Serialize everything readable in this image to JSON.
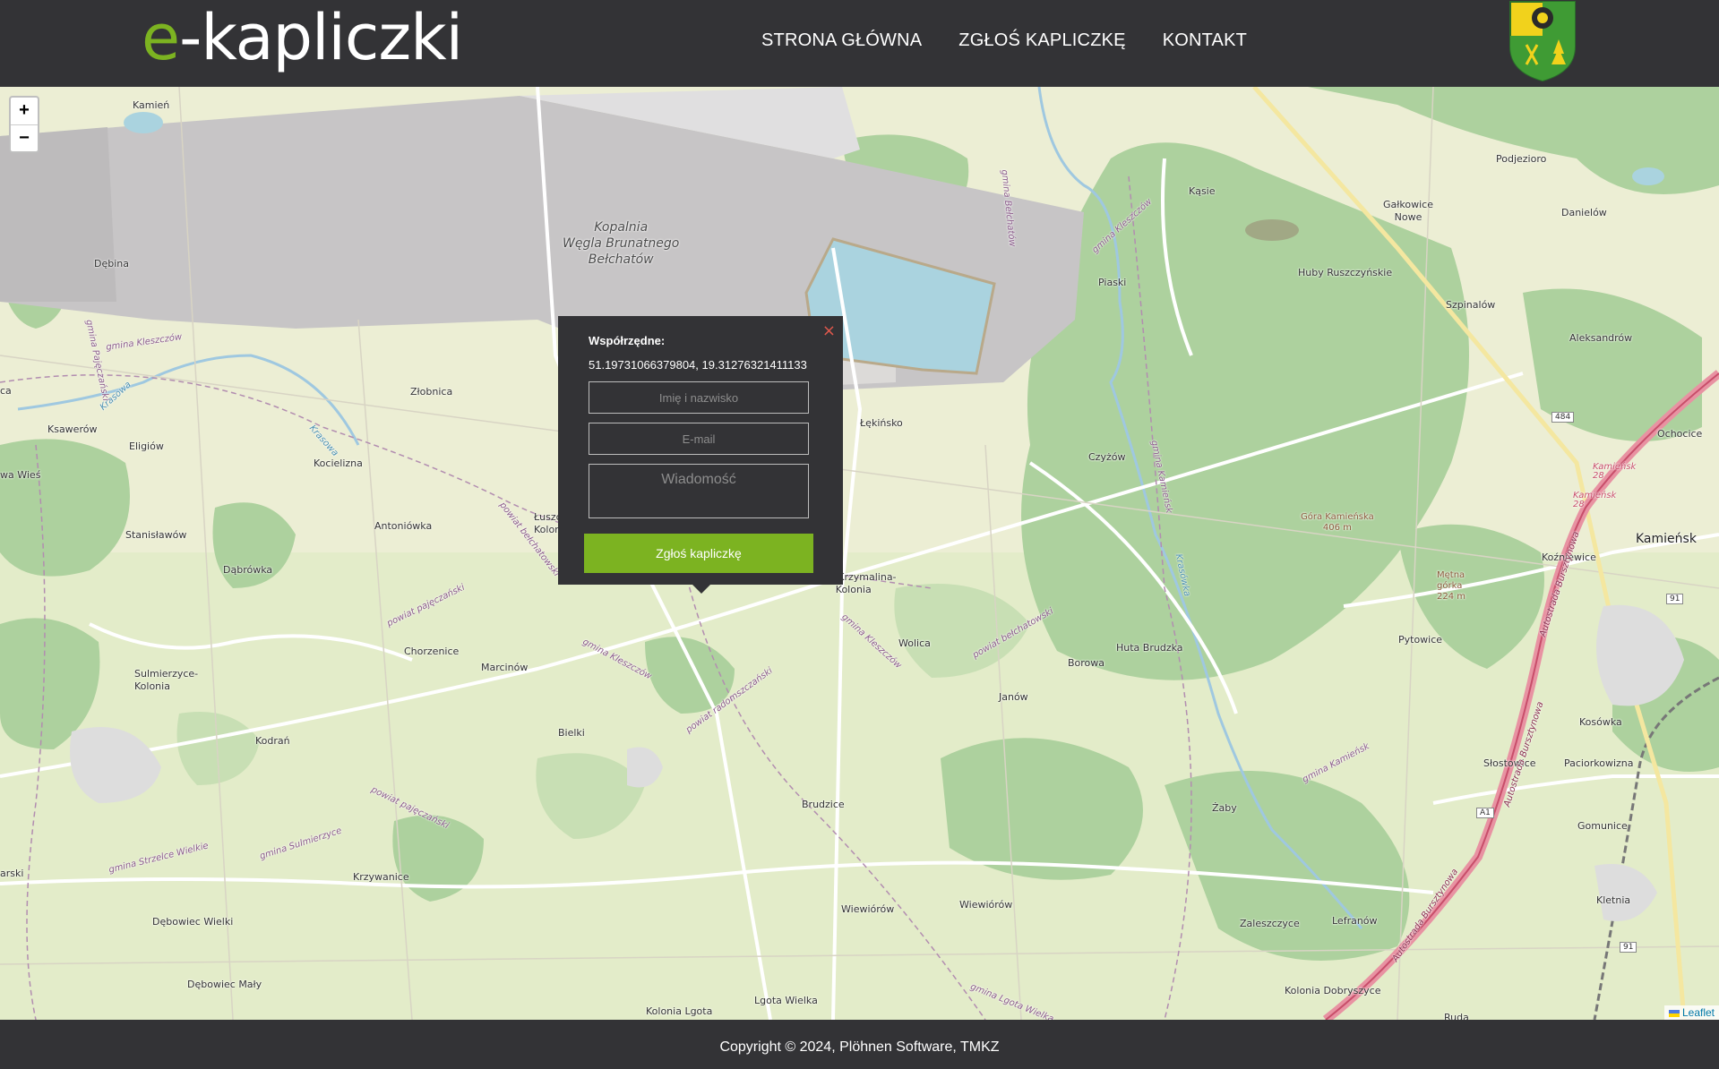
{
  "header": {
    "logo_prefix": "e",
    "logo_rest": "-kapliczki",
    "nav": [
      {
        "label": "STRONA GŁÓWNA"
      },
      {
        "label": "ZGŁOŚ KAPLICZKĘ"
      },
      {
        "label": "KONTAKT"
      }
    ],
    "crest_icon": "coat-of-arms-icon"
  },
  "map": {
    "zoom_in": "+",
    "zoom_out": "−",
    "attribution": "Leaflet",
    "places": {
      "kamien": "Kamień",
      "debina": "Dębina",
      "zlobnica": "Złobnica",
      "ksawerow": "Ksawerów",
      "eligiow": "Eligiów",
      "kocielizna": "Kocielizna",
      "wawies": "wa Wieś",
      "antoniowka": "Antoniówka",
      "stanislawow": "Stanisławów",
      "dabrowka": "Dąbrówka",
      "sulmierzyce": "Sulmierzyce-\nKolonia",
      "chorzenice": "Chorzenice",
      "marcinow": "Marcinów",
      "kodran": "Kodrań",
      "bielki": "Bielki",
      "brudzice": "Brudzice",
      "krzywanice": "Krzywanice",
      "debowiec_wielki": "Dębowiec Wielki",
      "debowiec_maly": "Dębowiec Mały",
      "kolonia_lgota": "Kolonia Lgota",
      "lgota_wielka": "Lgota Wielka",
      "wiewiorow1": "Wiewiórów",
      "wiewiorow2": "Wiewiórów",
      "wolica": "Wolica",
      "borowa": "Borowa",
      "janow": "Janów",
      "huta_brudzka": "Huta Brudzka",
      "czyzow": "Czyżów",
      "piaski": "Piaski",
      "lekinsko": "Łękińsko",
      "wola_krzymalina": "Wola Krzymalina-\nKolonia",
      "kasie": "Kąsie",
      "huby": "Huby Ruszczyńskie",
      "galkowice": "Gałkowice\nNowe",
      "podjezioro": "Podjezioro",
      "danielow": "Danielów",
      "szpinalow": "Szpinalów",
      "aleksandrow": "Aleksandrów",
      "ochocice": "Ochocice",
      "kamiensk": "Kamieńsk",
      "kozniewice": "Koźniewice",
      "pytowice": "Pytowice",
      "kosowka": "Kosówka",
      "slostowice": "Słostowice",
      "paciorkowizna": "Paciorkowizna",
      "gomunice": "Gomunice",
      "kletnia": "Kletnia",
      "zaby": "Żaby",
      "zaleszczyce": "Zaleszczyce",
      "lefranow": "Lefranów",
      "kolonia_dobryszyce": "Kolonia Dobryszyce",
      "ruda": "Ruda",
      "gora_kamienska": "Góra Kamieńska\n406 m",
      "metna_gorka": "Mętna\ngórka\n224 m",
      "kopalnia": "Kopalnia\nWęgla Brunatnego\nBełchatów",
      "luszczanowice": "Łuszc\nKolon",
      "arski": "arski",
      "ca": "ca"
    },
    "admin_labels": {
      "a1": "gmina Kleszczów",
      "a2": "powiat bełchatowski",
      "a3": "powiat pajęczański",
      "a4": "gmina Kleszczów",
      "a5": "powiat radomszczański",
      "a6": "gmina Kleszczów",
      "a7": "powiat bełchatowski",
      "a8": "powiat pajęczański",
      "a9": "gmina Strzelce Wielkie",
      "a10": "gmina Sulmierzyce",
      "a11": "gmina Lgota Wielka",
      "a12": "gmina Kamieńsk",
      "a13": "gmina Bełchatów",
      "a14": "gmina Kleszczów",
      "a15": "gmina Kamieńsk",
      "a16": "Autostrada Bursztynowa",
      "a17": "Autostrada Bursztynowa",
      "a18": "Autostrada Bursztynowa",
      "a19": "Krasowa",
      "a20": "Krasowa",
      "a21": "Kamieńsk\n28",
      "a22": "Kamieńsk\n28",
      "a23": "gmina Pajęczański",
      "a24": "Krasówka"
    },
    "road_refs": {
      "r484": "484",
      "r91a": "91",
      "r91b": "91",
      "ra1": "A1"
    }
  },
  "popup": {
    "label": "Współrzędne:",
    "coords": "51.19731066379804, 19.31276321411133",
    "name_placeholder": "Imię i nazwisko",
    "email_placeholder": "E-mail",
    "message_placeholder": "Wiadomość",
    "submit_label": "Zgłoś kapliczkę",
    "close_label": "×"
  },
  "footer": {
    "copyright": "Copyright © 2024, Plöhnen Software, TMKZ"
  },
  "colors": {
    "accent": "#7cb321",
    "dark": "#333336",
    "forest": "#add19e",
    "mine": "#c7c5c6",
    "water": "#aad3df"
  }
}
